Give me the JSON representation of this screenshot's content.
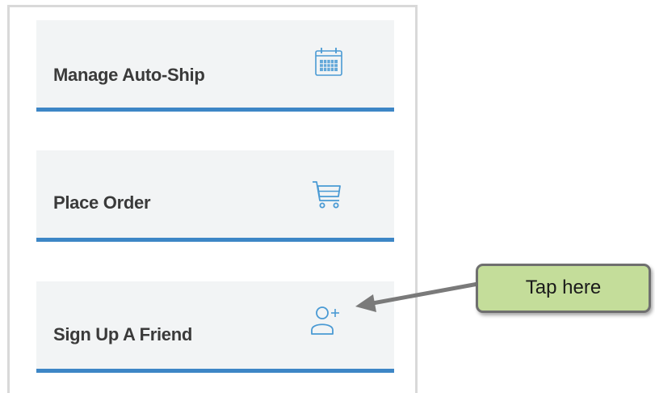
{
  "menu": {
    "items": [
      {
        "label": "Manage Auto-Ship",
        "icon": "calendar-icon"
      },
      {
        "label": "Place Order",
        "icon": "cart-icon"
      },
      {
        "label": "Sign Up A Friend",
        "icon": "add-user-icon"
      }
    ],
    "accent_color": "#3d86c6",
    "icon_color": "#4a9ad4"
  },
  "callout": {
    "text": "Tap here",
    "background": "#c4dd9a"
  }
}
